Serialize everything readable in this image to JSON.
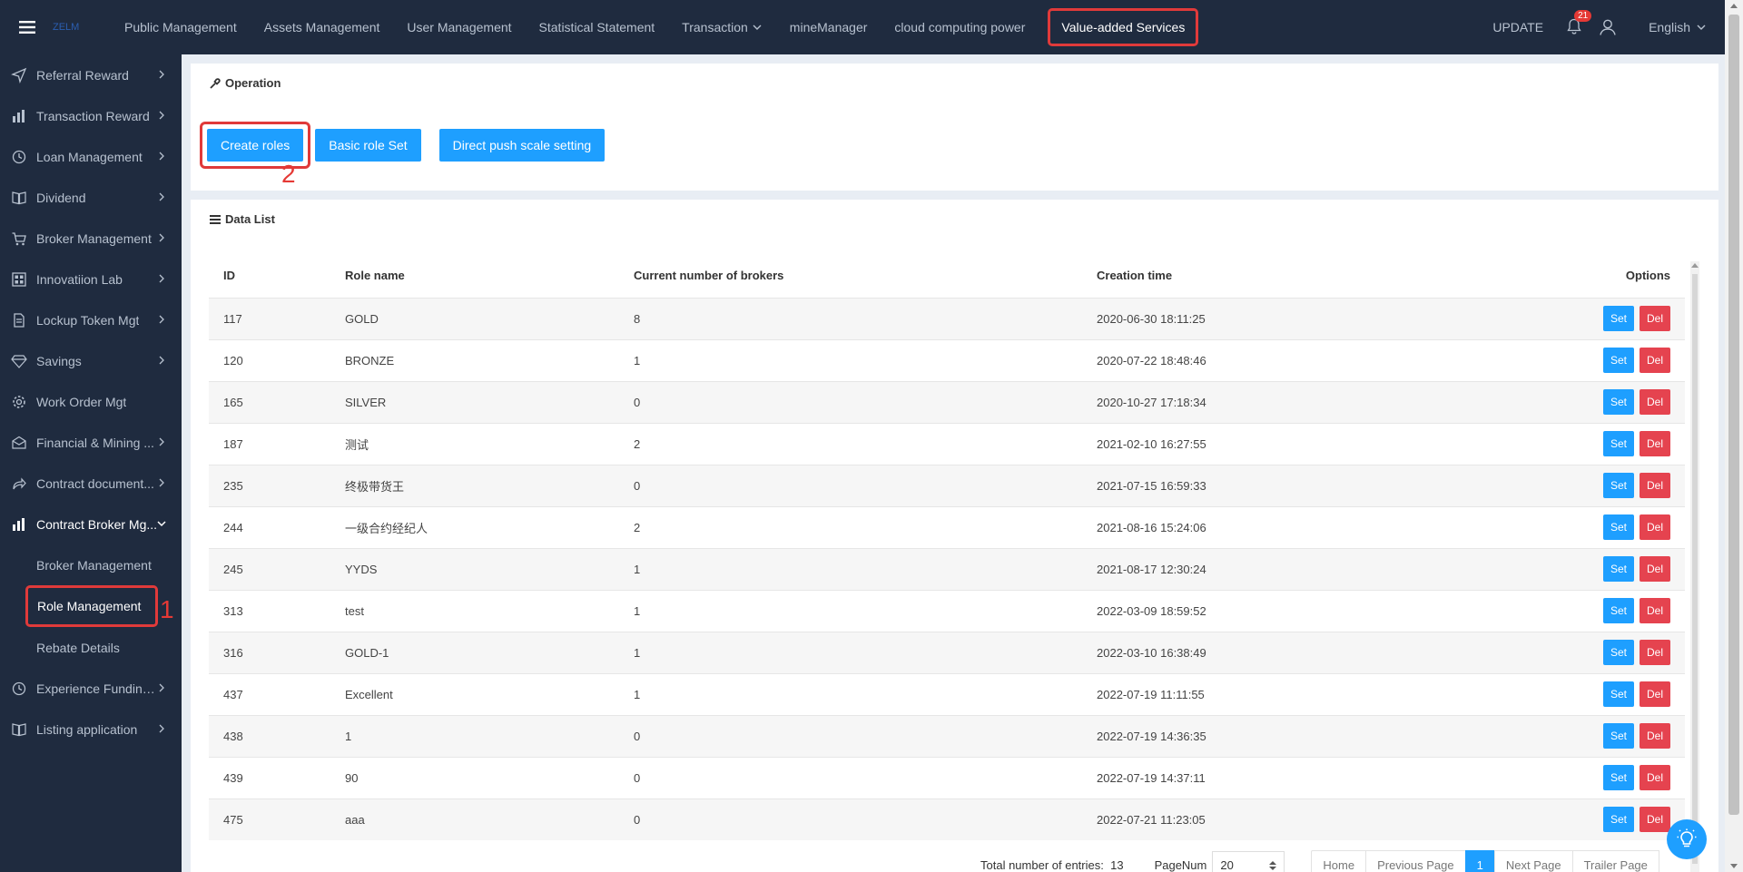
{
  "header": {
    "logo_text": "ZELM",
    "nav": [
      {
        "label": "Public Management"
      },
      {
        "label": "Assets Management"
      },
      {
        "label": "User Management"
      },
      {
        "label": "Statistical Statement"
      },
      {
        "label": "Transaction"
      },
      {
        "label": "mineManager"
      },
      {
        "label": "cloud computing power"
      },
      {
        "label": "Value-added Services"
      }
    ],
    "update_label": "UPDATE",
    "notification_count": "21",
    "language": "English"
  },
  "sidebar": {
    "items": [
      {
        "label": "Referral Reward",
        "icon": "send-icon"
      },
      {
        "label": "Transaction Reward",
        "icon": "bar-chart-icon"
      },
      {
        "label": "Loan Management",
        "icon": "clock-icon"
      },
      {
        "label": "Dividend",
        "icon": "book-icon"
      },
      {
        "label": "Broker Management",
        "icon": "cart-icon"
      },
      {
        "label": "Innovatiion Lab",
        "icon": "grid-icon"
      },
      {
        "label": "Lockup Token Mgt",
        "icon": "file-icon"
      },
      {
        "label": "Savings",
        "icon": "diamond-icon"
      },
      {
        "label": "Work Order Mgt",
        "icon": "gear-icon"
      },
      {
        "label": "Financial & Mining ...",
        "icon": "mail-icon"
      },
      {
        "label": "Contract document...",
        "icon": "share-icon"
      },
      {
        "label": "Contract Broker Mg...",
        "icon": "bar-chart-icon"
      }
    ],
    "sub_items": [
      {
        "label": "Broker Management"
      },
      {
        "label": "Role Management"
      },
      {
        "label": "Rebate Details"
      }
    ],
    "items_after": [
      {
        "label": "Experience Funding...",
        "icon": "clock-icon"
      },
      {
        "label": "Listing application",
        "icon": "book-icon"
      }
    ]
  },
  "markers": {
    "one": "1",
    "two": "2"
  },
  "operation": {
    "title": "Operation",
    "buttons": {
      "create": "Create roles",
      "basic": "Basic role Set",
      "direct": "Direct push scale setting"
    }
  },
  "data_list": {
    "title": "Data List",
    "columns": {
      "id": "ID",
      "role": "Role name",
      "brokers": "Current number of brokers",
      "created": "Creation time",
      "options": "Options"
    },
    "set_label": "Set",
    "del_label": "Del",
    "rows": [
      {
        "id": "117",
        "role": "GOLD",
        "brokers": "8",
        "created": "2020-06-30 18:11:25"
      },
      {
        "id": "120",
        "role": "BRONZE",
        "brokers": "1",
        "created": "2020-07-22 18:48:46"
      },
      {
        "id": "165",
        "role": "SILVER",
        "brokers": "0",
        "created": "2020-10-27 17:18:34"
      },
      {
        "id": "187",
        "role": "测试",
        "brokers": "2",
        "created": "2021-02-10 16:27:55"
      },
      {
        "id": "235",
        "role": "终极带货王",
        "brokers": "0",
        "created": "2021-07-15 16:59:33"
      },
      {
        "id": "244",
        "role": "一级合约经纪人",
        "brokers": "2",
        "created": "2021-08-16 15:24:06"
      },
      {
        "id": "245",
        "role": "YYDS",
        "brokers": "1",
        "created": "2021-08-17 12:30:24"
      },
      {
        "id": "313",
        "role": "test",
        "brokers": "1",
        "created": "2022-03-09 18:59:52"
      },
      {
        "id": "316",
        "role": "GOLD-1",
        "brokers": "1",
        "created": "2022-03-10 16:38:49"
      },
      {
        "id": "437",
        "role": "Excellent",
        "brokers": "1",
        "created": "2022-07-19 11:11:55"
      },
      {
        "id": "438",
        "role": "1",
        "brokers": "0",
        "created": "2022-07-19 14:36:35"
      },
      {
        "id": "439",
        "role": "90",
        "brokers": "0",
        "created": "2022-07-19 14:37:11"
      },
      {
        "id": "475",
        "role": "aaa",
        "brokers": "0",
        "created": "2022-07-21 11:23:05"
      }
    ]
  },
  "pagination": {
    "total_label": "Total number of entries:",
    "total": "13",
    "pagenum_label": "PageNum",
    "page_size": "20",
    "home": "Home",
    "previous": "Previous Page",
    "current": "1",
    "next": "Next Page",
    "trailer": "Trailer Page"
  },
  "colors": {
    "topbar": "#1f2b3f",
    "accent": "#1e9fff",
    "danger": "#e5434f",
    "highlight": "#e03a3a"
  }
}
